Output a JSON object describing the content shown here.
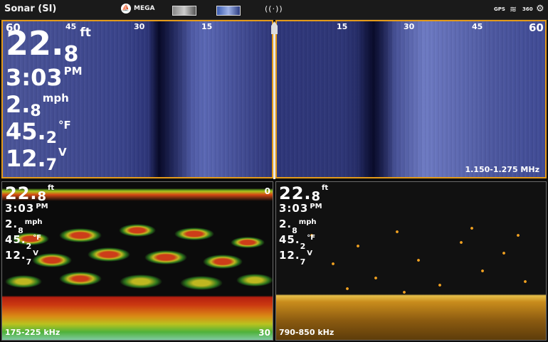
{
  "status_bar": {
    "title": "Sonar (SI)",
    "mega_label": "MEGA",
    "gps_label": "GPS",
    "degrees_label": "360",
    "icons": [
      "mega-icon",
      "imaging-view-icon",
      "side-imaging-view-icon",
      "nmea-network-icon",
      "gps-icon",
      "satellite-icon",
      "compass-360-icon",
      "settings-gear-icon"
    ]
  },
  "side_imaging": {
    "left_scale": [
      "60",
      "45",
      "30",
      "15"
    ],
    "right_scale": [
      "15",
      "30",
      "45",
      "60"
    ],
    "frequency": "1.150-1.275 MHz",
    "readouts": {
      "depth": {
        "main": "22.",
        "dec": "8",
        "unit": "ft"
      },
      "time": {
        "main": "3:03",
        "dec": "",
        "unit": "PM"
      },
      "speed": {
        "main": "2.",
        "dec": "8",
        "unit": "mph"
      },
      "temp": {
        "main": "45.",
        "dec": "2",
        "unit": "°F"
      },
      "voltage": {
        "main": "12.",
        "dec": "7",
        "unit": "V"
      }
    }
  },
  "down_sonar_low": {
    "frequency": "175-225 kHz",
    "top_depth": "0",
    "bottom_depth": "30",
    "readouts": {
      "depth": {
        "main": "22.",
        "dec": "8",
        "unit": "ft"
      },
      "time": {
        "main": "3:03",
        "dec": "",
        "unit": "PM"
      },
      "speed": {
        "main": "2.",
        "dec": "8",
        "unit": "mph"
      },
      "temp": {
        "main": "45.",
        "dec": "2",
        "unit": "°F"
      },
      "voltage": {
        "main": "12.",
        "dec": "7",
        "unit": "V"
      }
    }
  },
  "down_sonar_high": {
    "frequency": "790-850 kHz",
    "readouts": {
      "depth": {
        "main": "22.",
        "dec": "8",
        "unit": "ft"
      },
      "time": {
        "main": "3:03",
        "dec": "",
        "unit": "PM"
      },
      "speed": {
        "main": "2.",
        "dec": "8",
        "unit": "mph"
      },
      "temp": {
        "main": "45.",
        "dec": "2",
        "unit": "°F"
      },
      "voltage": {
        "main": "12.",
        "dec": "7",
        "unit": "V"
      }
    }
  },
  "colors": {
    "active_border": "#e39a1a",
    "side_imaging_blue": "#3b4590",
    "status_bar_bg": "#1a1a1a"
  }
}
